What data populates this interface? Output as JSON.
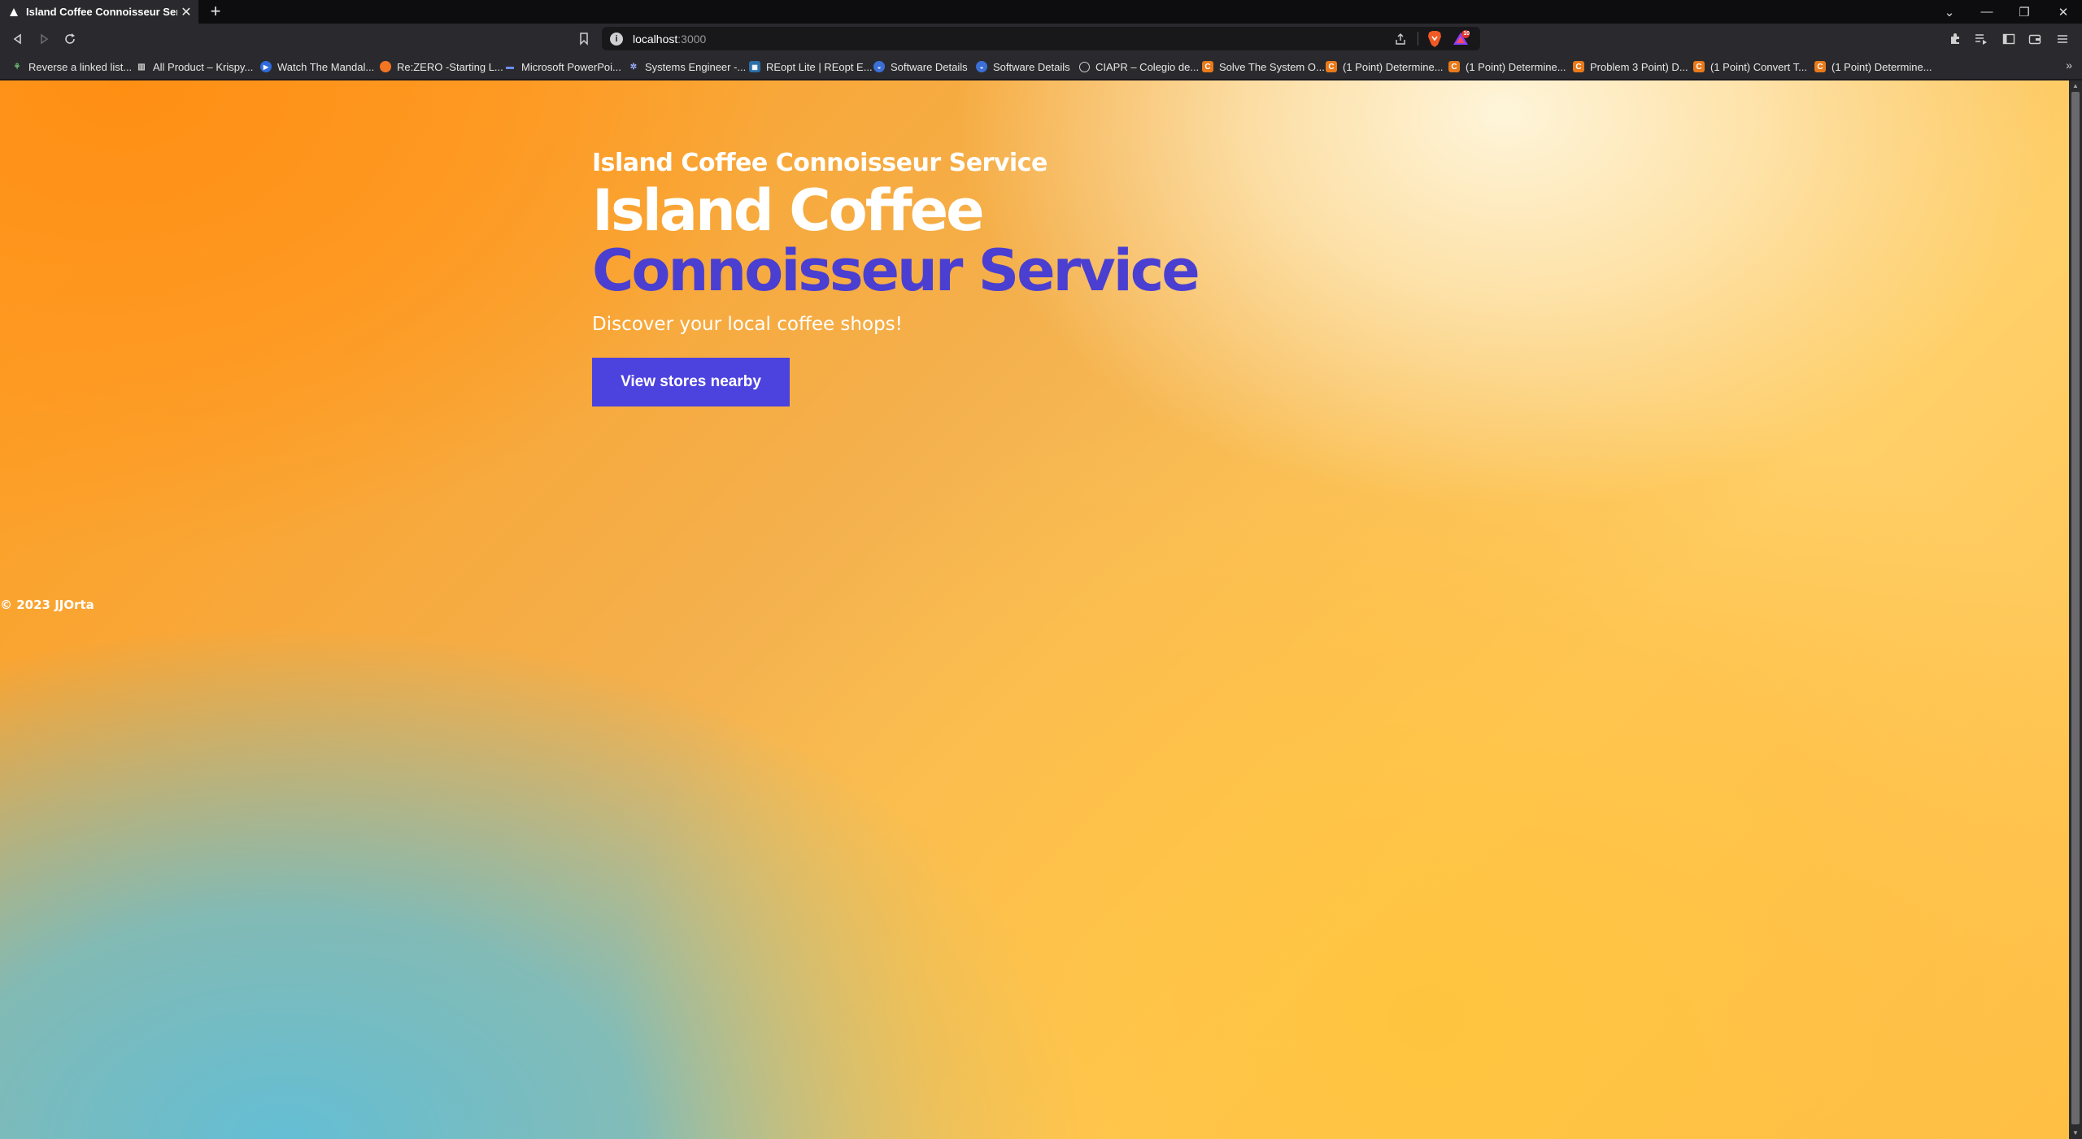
{
  "browser": {
    "tab": {
      "title": "Island Coffee Connoisseur Service",
      "icon": "triangle-icon"
    },
    "address_host": "localhost",
    "address_port": ":3000",
    "bookmarks": [
      {
        "label": "Reverse a linked list...",
        "icon": "leaf-icon"
      },
      {
        "label": "All Product – Krispy...",
        "icon": "bars-icon"
      },
      {
        "label": "Watch The Mandal...",
        "icon": "play-icon"
      },
      {
        "label": "Re:ZERO -Starting L...",
        "icon": "crunchyroll-icon"
      },
      {
        "label": "Microsoft PowerPoi...",
        "icon": "dash-icon"
      },
      {
        "label": "Systems Engineer -...",
        "icon": "gear-icon"
      },
      {
        "label": "REopt Lite | REopt E...",
        "icon": "reopt-icon"
      },
      {
        "label": "Software Details",
        "icon": "globe-icon"
      },
      {
        "label": "Software Details",
        "icon": "globe-icon"
      },
      {
        "label": "CIAPR – Colegio de...",
        "icon": "chrome-icon"
      },
      {
        "label": "Solve The System O...",
        "icon": "chegg-icon"
      },
      {
        "label": "(1 Point) Determine...",
        "icon": "chegg-icon"
      },
      {
        "label": "(1 Point) Determine...",
        "icon": "chegg-icon"
      },
      {
        "label": "Problem 3 Point) D...",
        "icon": "chegg-icon"
      },
      {
        "label": "(1 Point) Convert T...",
        "icon": "chegg-icon"
      },
      {
        "label": "(1 Point) Determine...",
        "icon": "chegg-icon"
      }
    ],
    "rewards_badge": "10"
  },
  "page": {
    "eyebrow": "Island Coffee Connoisseur Service",
    "headline_part1": "Island Coffee",
    "headline_part2": "Connoisseur Service",
    "subtitle": "Discover your local coffee shops!",
    "cta_label": "View stores nearby",
    "footer": "© 2023 JJOrta"
  },
  "colors": {
    "accent": "#4a3fd1",
    "button": "#4c42de",
    "gradient_orange": "#ff9a1a",
    "gradient_cream": "#fff3d6",
    "gradient_blue": "#64bed4"
  }
}
